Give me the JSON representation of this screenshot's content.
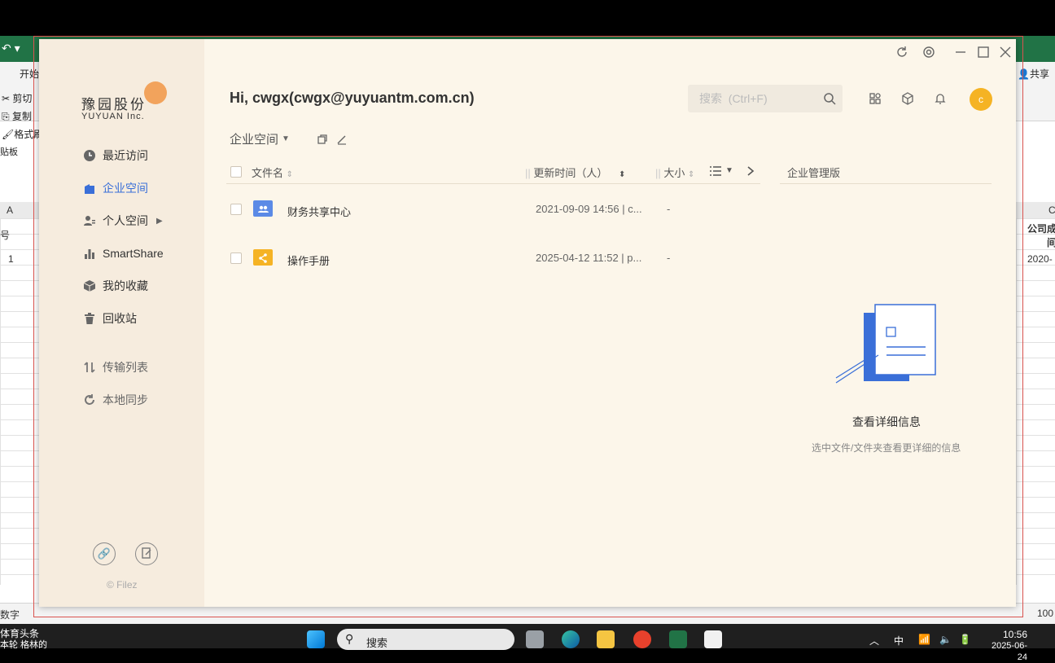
{
  "excel": {
    "tab_start": "开始",
    "cut": "剪切",
    "copy": "复制",
    "format_painter": "格式刷",
    "clipboard": "贴板",
    "col_a": "A",
    "col_c": "C",
    "cell_a_label": "号",
    "cell_a1": "1",
    "cell_right_header_1": "公司成",
    "cell_right_header_2": "间",
    "cell_right_value": "2020-",
    "share": "共享",
    "status": "数字",
    "zoom": "100"
  },
  "app": {
    "logo_cn": "豫园股份",
    "logo_en": "YUYUAN Inc.",
    "greeting": "Hi, cwgx(cwgx@yuyuantm.com.cn)",
    "search_placeholder": "搜索  (Ctrl+F)",
    "avatar_letter": "c",
    "nav": [
      {
        "label": "最近访问",
        "icon": "clock-icon"
      },
      {
        "label": "企业空间",
        "icon": "building-icon"
      },
      {
        "label": "个人空间",
        "icon": "user-icon"
      },
      {
        "label": "SmartShare",
        "icon": "bar-chart-icon"
      },
      {
        "label": "我的收藏",
        "icon": "box-icon"
      },
      {
        "label": "回收站",
        "icon": "trash-icon"
      },
      {
        "label": "传输列表",
        "icon": "transfer-icon"
      },
      {
        "label": "本地同步",
        "icon": "sync-icon"
      }
    ],
    "copyright": "© Filez",
    "breadcrumb": "企业空间",
    "columns": {
      "name": "文件名",
      "updated": "更新时间（人）",
      "size": "大小"
    },
    "files": [
      {
        "name": "财务共享中心",
        "updated": "2021-09-09 14:56 | c...",
        "size": "-"
      },
      {
        "name": "操作手册",
        "updated": "2025-04-12 11:52 | p...",
        "size": "-"
      }
    ],
    "right_tab": "企业管理版",
    "empty_title": "查看详细信息",
    "empty_subtitle": "选中文件/文件夹查看更详细的信息"
  },
  "taskbar": {
    "news_title": "体育头条",
    "news_sub": "本轮 格林的",
    "search": "搜索",
    "ime": "中",
    "time": "10:56",
    "date": "2025-06-24"
  }
}
